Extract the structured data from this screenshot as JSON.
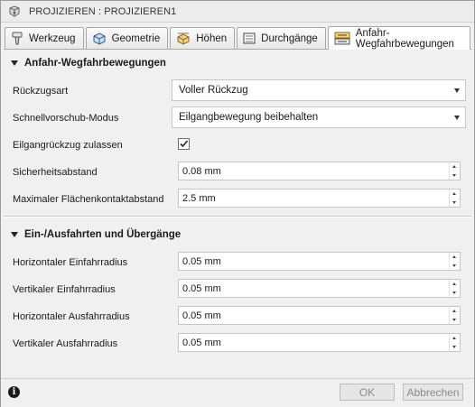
{
  "window": {
    "title": "PROJIZIEREN : PROJIZIEREN1"
  },
  "tabs": [
    {
      "label": "Werkzeug",
      "icon": "tool-icon"
    },
    {
      "label": "Geometrie",
      "icon": "geometry-icon"
    },
    {
      "label": "Höhen",
      "icon": "heights-icon"
    },
    {
      "label": "Durchgänge",
      "icon": "passes-icon"
    },
    {
      "label": "Anfahr-Wegfahrbewegungen",
      "icon": "linking-icon",
      "active": true
    }
  ],
  "section1": {
    "title": "Anfahr-Wegfahrbewegungen",
    "retract_type": {
      "label": "Rückzugsart",
      "value": "Voller Rückzug"
    },
    "rapid_mode": {
      "label": "Schnellvorschub-Modus",
      "value": "Eilgangbewegung beibehalten"
    },
    "allow_rapid_retract": {
      "label": "Eilgangrückzug zulassen",
      "checked": true
    },
    "safe_distance": {
      "label": "Sicherheitsabstand",
      "value": "0.08 mm"
    },
    "max_stay_down": {
      "label": "Maximaler Flächenkontaktabstand",
      "value": "2.5 mm"
    }
  },
  "section2": {
    "title": "Ein-/Ausfahrten und Übergänge",
    "h_lead_in": {
      "label": "Horizontaler Einfahrradius",
      "value": "0.05 mm"
    },
    "v_lead_in": {
      "label": "Vertikaler Einfahrradius",
      "value": "0.05 mm"
    },
    "h_lead_out": {
      "label": "Horizontaler Ausfahrradius",
      "value": "0.05 mm"
    },
    "v_lead_out": {
      "label": "Vertikaler Ausfahrradius",
      "value": "0.05 mm"
    }
  },
  "footer": {
    "ok_label": "OK",
    "cancel_label": "Abbrechen",
    "info_glyph": "i"
  }
}
